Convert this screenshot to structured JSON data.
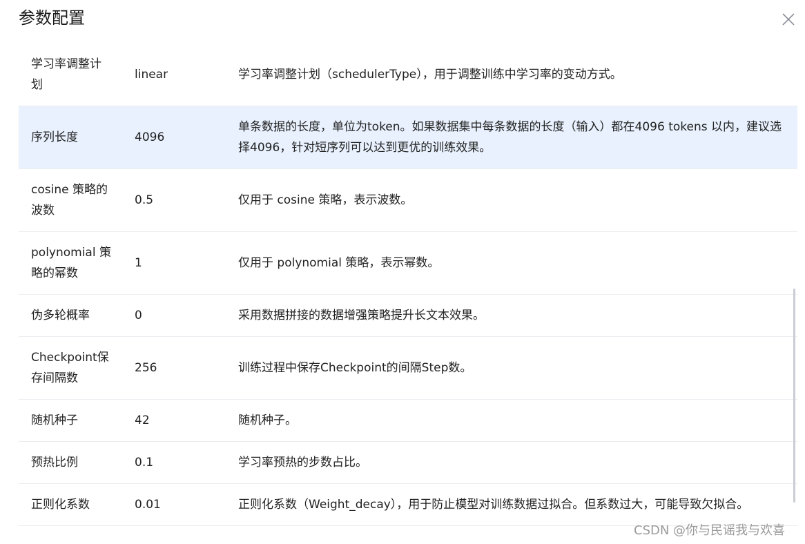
{
  "dialog": {
    "title": "参数配置",
    "close_icon": "close-icon"
  },
  "rows": [
    {
      "name": "学习率调整计划",
      "value": "linear",
      "desc": "学习率调整计划（schedulerType），用于调整训练中学习率的变动方式。",
      "highlighted": false
    },
    {
      "name": "序列长度",
      "value": "4096",
      "desc": "单条数据的长度，单位为token。如果数据集中每条数据的长度（输入）都在4096 tokens 以内，建议选择4096，针对短序列可以达到更优的训练效果。",
      "highlighted": true
    },
    {
      "name": "cosine 策略的波数",
      "value": "0.5",
      "desc": "仅用于 cosine 策略，表示波数。",
      "highlighted": false
    },
    {
      "name": "polynomial 策略的幂数",
      "value": "1",
      "desc": "仅用于 polynomial 策略，表示幂数。",
      "highlighted": false
    },
    {
      "name": "伪多轮概率",
      "value": "0",
      "desc": "采用数据拼接的数据增强策略提升长文本效果。",
      "highlighted": false
    },
    {
      "name": "Checkpoint保存间隔数",
      "value": "256",
      "desc": "训练过程中保存Checkpoint的间隔Step数。",
      "highlighted": false
    },
    {
      "name": "随机种子",
      "value": "42",
      "desc": "随机种子。",
      "highlighted": false
    },
    {
      "name": "预热比例",
      "value": "0.1",
      "desc": "学习率预热的步数占比。",
      "highlighted": false
    },
    {
      "name": "正则化系数",
      "value": "0.01",
      "desc": "正则化系数（Weight_decay），用于防止模型对训练数据过拟合。但系数过大，可能导致欠拟合。",
      "highlighted": false
    }
  ],
  "watermark": "CSDN @你与民谣我与欢喜",
  "colors": {
    "highlight_row": "#e8f1fd",
    "divider": "#ebedf0",
    "text": "#222222"
  }
}
